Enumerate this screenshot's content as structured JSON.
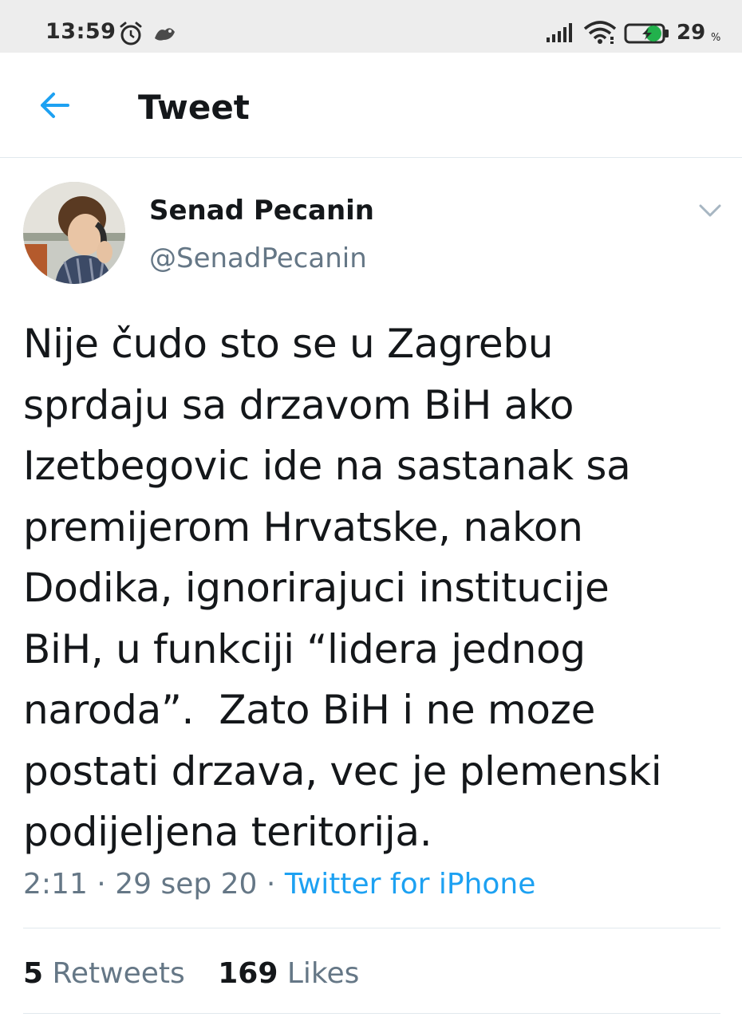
{
  "status_bar": {
    "time": "13:59",
    "battery_level": "29",
    "battery_unit": "%",
    "icons": [
      "alarm-icon",
      "app-notification-icon",
      "signal-icon",
      "wifi-icon",
      "battery-charging-icon"
    ]
  },
  "header": {
    "title": "Tweet",
    "back_icon": "arrow-left-icon"
  },
  "tweet": {
    "author_name": "Senad Pecanin",
    "author_handle": "@SenadPecanin",
    "text": "Nije čudo sto se u Zagrebu\nsprdaju sa drzavom BiH ako\nIzetbegovic ide na sastanak sa\npremijerom Hrvatske, nakon\nDodika, ignorirajuci institucije\nBiH, u funkciji “lidera jednog\nnaroda”.  Zato BiH i ne moze\npostati drzava, vec je plemenski\npodijeljena teritorija.",
    "time": "2:11",
    "date": "29 sep 20",
    "separator": "·",
    "source": "Twitter for iPhone",
    "retweet_count": "5",
    "retweet_label": "Retweets",
    "like_count": "169",
    "like_label": "Likes"
  },
  "colors": {
    "accent": "#1da1f2",
    "secondary_text": "#657786",
    "primary_text": "#14171a",
    "divider": "#e1e8ed",
    "status_bar_bg": "#ededed"
  }
}
